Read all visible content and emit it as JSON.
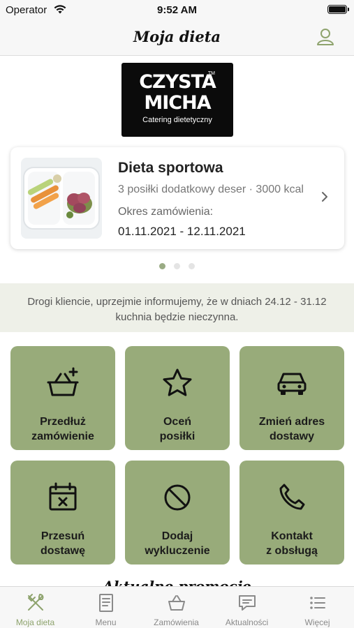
{
  "status_bar": {
    "carrier": "Operator",
    "time": "9:52 AM"
  },
  "header": {
    "title": "Moja dieta",
    "profile_icon": "user-icon"
  },
  "logo": {
    "line1": "CZYSTA",
    "line2": "MICHA",
    "trademark": "TM",
    "subtitle": "Catering dietetyczny"
  },
  "diet_card": {
    "name": "Dieta sportowa",
    "description": "3 posiłki dodatkowy deser · 3000 kcal",
    "period_label": "Okres zamówienia:",
    "period": "01.11.2021 - 12.11.2021"
  },
  "carousel": {
    "pages": 3,
    "active": 0
  },
  "notice": {
    "text": "Drogi kliencie, uprzejmie informujemy, że w dniach 24.12 - 31.12 kuchnia będzie nieczynna."
  },
  "tiles": [
    {
      "label": "Przedłuż\nzamówienie",
      "icon": "basket-plus-icon"
    },
    {
      "label": "Oceń\nposiłki",
      "icon": "star-icon"
    },
    {
      "label": "Zmień adres\ndostawy",
      "icon": "car-icon"
    },
    {
      "label": "Przesuń\ndostawę",
      "icon": "calendar-x-icon"
    },
    {
      "label": "Dodaj\nwykluczenie",
      "icon": "ban-icon"
    },
    {
      "label": "Kontakt\nz obsługą",
      "icon": "phone-icon"
    }
  ],
  "promo_heading": "Aktualne promocje",
  "tabbar": [
    {
      "label": "Moja dieta",
      "icon": "cutlery-icon",
      "active": true
    },
    {
      "label": "Menu",
      "icon": "menu-doc-icon",
      "active": false
    },
    {
      "label": "Zamówienia",
      "icon": "basket-icon",
      "active": false
    },
    {
      "label": "Aktualności",
      "icon": "message-icon",
      "active": false
    },
    {
      "label": "Więcej",
      "icon": "list-icon",
      "active": false
    }
  ],
  "colors": {
    "accent": "#98ab7a",
    "accent_dark": "#8ea36d",
    "notice_bg": "#eef0e8",
    "logo_bg": "#0b0b0b"
  }
}
